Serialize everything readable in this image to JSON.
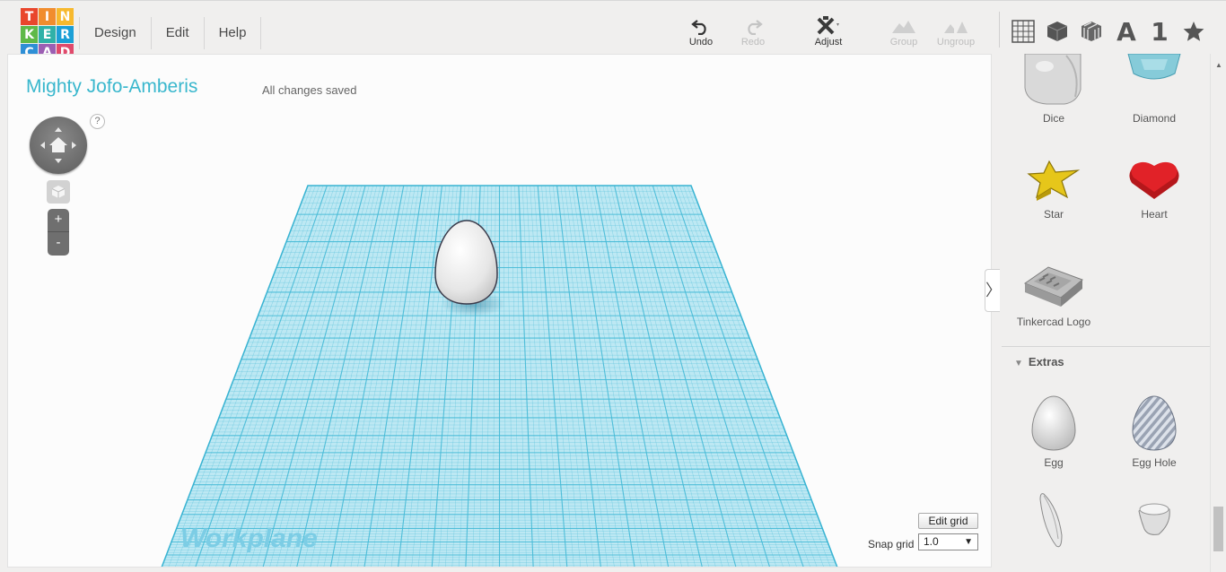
{
  "logo": {
    "letters": [
      "T",
      "I",
      "N",
      "K",
      "E",
      "R",
      "C",
      "A",
      "D"
    ],
    "colors": [
      "#e9462c",
      "#f18d2e",
      "#f7b92e",
      "#5fb948",
      "#2fb1a8",
      "#1b9fd6",
      "#2e8fd6",
      "#9c5fb3",
      "#e04a6c"
    ]
  },
  "menu": [
    "Design",
    "Edit",
    "Help"
  ],
  "toolbar": {
    "undo": "Undo",
    "redo": "Redo",
    "adjust": "Adjust",
    "group": "Group",
    "ungroup": "Ungroup",
    "view_text_label": "A",
    "view_number_label": "1"
  },
  "design": {
    "title": "Mighty Jofo-Amberis",
    "save_status": "All changes saved"
  },
  "nav": {
    "help": "?",
    "zoom_in": "+",
    "zoom_out": "-"
  },
  "workplane": {
    "label": "Workplane",
    "grid_color": "#44b9d6"
  },
  "grid_controls": {
    "edit_grid": "Edit grid",
    "snap_label": "Snap grid",
    "snap_value": "1.0"
  },
  "shapes": [
    {
      "label": "Dice"
    },
    {
      "label": "Diamond"
    },
    {
      "label": "Star"
    },
    {
      "label": "Heart"
    },
    {
      "label": "Tinkercad Logo"
    }
  ],
  "extras": {
    "heading": "Extras",
    "items": [
      {
        "label": "Egg"
      },
      {
        "label": "Egg Hole"
      }
    ]
  }
}
